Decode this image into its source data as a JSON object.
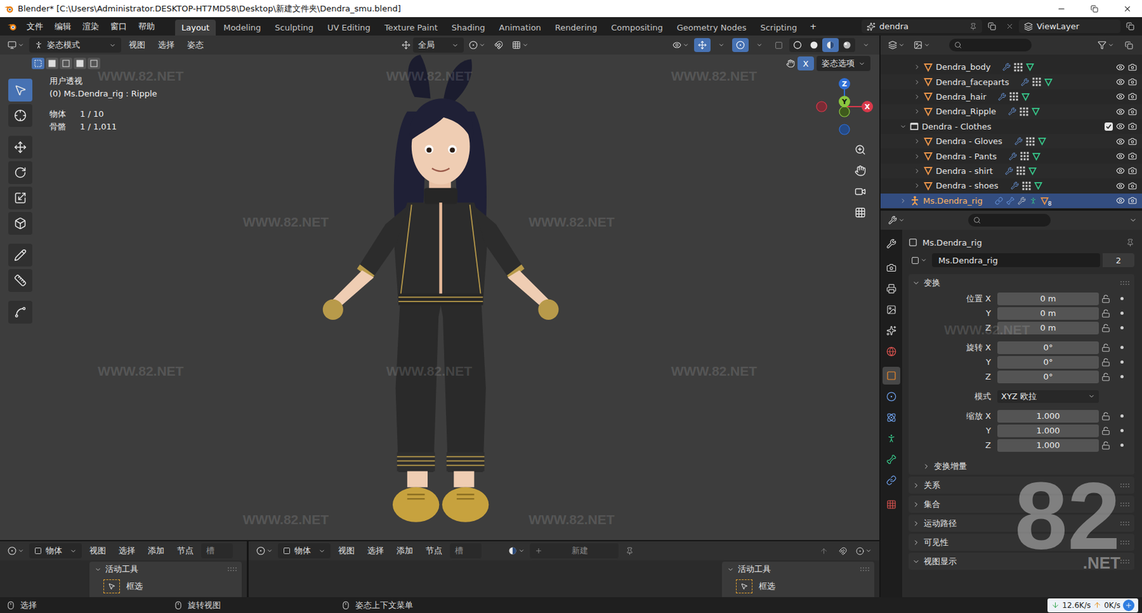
{
  "window": {
    "title": "Blender* [C:\\Users\\Administrator.DESKTOP-HT7MD58\\Desktop\\新建文件夹\\Dendra_smu.blend]"
  },
  "menu": [
    "文件",
    "编辑",
    "渲染",
    "窗口",
    "帮助"
  ],
  "workspaces": [
    {
      "label": "Layout",
      "selected": true
    },
    {
      "label": "Modeling",
      "selected": false
    },
    {
      "label": "Sculpting",
      "selected": false
    },
    {
      "label": "UV Editing",
      "selected": false
    },
    {
      "label": "Texture Paint",
      "selected": false
    },
    {
      "label": "Shading",
      "selected": false
    },
    {
      "label": "Animation",
      "selected": false
    },
    {
      "label": "Rendering",
      "selected": false
    },
    {
      "label": "Compositing",
      "selected": false
    },
    {
      "label": "Geometry Nodes",
      "selected": false
    },
    {
      "label": "Scripting",
      "selected": false
    }
  ],
  "add_workspace": "+",
  "scene": "dendra",
  "view_layer": "ViewLayer",
  "viewport": {
    "mode": "姿态模式",
    "menus": [
      "视图",
      "选择",
      "姿态"
    ],
    "orientation": "全局",
    "x_mirror": {
      "label": "X",
      "on": true
    },
    "pose_options": "姿态选项",
    "shading": [
      {
        "kind": "wireframe",
        "selected": false
      },
      {
        "kind": "solid",
        "selected": false
      },
      {
        "kind": "material",
        "selected": true
      },
      {
        "kind": "rendered",
        "selected": false
      }
    ],
    "view_name": "用户透视",
    "context": "(0) Ms.Dendra_rig : Ripple",
    "stats": [
      {
        "label": "物体",
        "value": "1 / 10"
      },
      {
        "label": "骨骼",
        "value": "1 / 1,011"
      }
    ],
    "gizmo": {
      "x": "X",
      "y": "Y",
      "z": "Z"
    },
    "tools": [
      {
        "kind": "select",
        "selected": true
      },
      {
        "kind": "cursor",
        "selected": false
      },
      {
        "kind": "move",
        "selected": false
      },
      {
        "kind": "rotate",
        "selected": false
      },
      {
        "kind": "scale",
        "selected": false
      },
      {
        "kind": "transform",
        "selected": false
      },
      {
        "kind": "annotate",
        "selected": false
      },
      {
        "kind": "measure",
        "selected": false
      },
      {
        "kind": "pose",
        "selected": false
      }
    ]
  },
  "bottom_editors": [
    {
      "editor": "物体",
      "menus": [
        "视图",
        "选择",
        "添加",
        "节点"
      ],
      "slot": "槽",
      "panel_title": "活动工具",
      "tool": "框选"
    },
    {
      "editor": "物体",
      "menus": [
        "视图",
        "选择",
        "添加",
        "节点"
      ],
      "slot": "槽",
      "new": "新建",
      "panel_title": "活动工具",
      "tool": "框选"
    }
  ],
  "status_bar": {
    "items": [
      "选择",
      "旋转视图",
      "姿态上下文菜单"
    ],
    "download": "12.6K/s",
    "upload": "0K/s"
  },
  "outliner": {
    "rows": [
      {
        "name": "Dendra_body",
        "kind": "mesh",
        "depth": 1,
        "expanded": false,
        "selected": false
      },
      {
        "name": "Dendra_faceparts",
        "kind": "mesh",
        "depth": 1,
        "expanded": false,
        "selected": false
      },
      {
        "name": "Dendra_hair",
        "kind": "mesh",
        "depth": 1,
        "expanded": false,
        "selected": false
      },
      {
        "name": "Dendra_Ripple",
        "kind": "mesh",
        "depth": 1,
        "expanded": false,
        "selected": false
      },
      {
        "name": "Dendra - Clothes",
        "kind": "collection",
        "depth": 0,
        "expanded": true,
        "selected": false,
        "checked": true
      },
      {
        "name": "Dendra - Gloves",
        "kind": "mesh",
        "depth": 1,
        "expanded": false,
        "selected": false
      },
      {
        "name": "Dendra - Pants",
        "kind": "mesh",
        "depth": 1,
        "expanded": false,
        "selected": false
      },
      {
        "name": "Dendra - shirt",
        "kind": "mesh",
        "depth": 1,
        "expanded": false,
        "selected": false
      },
      {
        "name": "Dendra - shoes",
        "kind": "mesh",
        "depth": 1,
        "expanded": false,
        "selected": false
      },
      {
        "name": "Ms.Dendra_rig",
        "kind": "armature",
        "depth": 0,
        "expanded": false,
        "selected": true,
        "badge": "8"
      }
    ]
  },
  "properties": {
    "object": "Ms.Dendra_rig",
    "datablock": "Ms.Dendra_rig",
    "users": "2",
    "tabs": [
      {
        "kind": "tool",
        "selected": false
      },
      {
        "kind": "render",
        "selected": false
      },
      {
        "kind": "output",
        "selected": false
      },
      {
        "kind": "view_layer",
        "selected": false
      },
      {
        "kind": "scene",
        "selected": false
      },
      {
        "kind": "world",
        "selected": false
      },
      {
        "kind": "object",
        "selected": true
      },
      {
        "kind": "constraint",
        "selected": false
      },
      {
        "kind": "physics",
        "selected": false
      },
      {
        "kind": "data",
        "selected": false
      },
      {
        "kind": "bone",
        "selected": false
      },
      {
        "kind": "bone_constraint",
        "selected": false
      },
      {
        "kind": "texture",
        "selected": false
      }
    ],
    "transform": {
      "title": "变换",
      "expanded": true,
      "groups": [
        {
          "kind": "fields",
          "rows": [
            {
              "label": "位置 X",
              "value": "0 m"
            },
            {
              "label": "Y",
              "value": "0 m"
            },
            {
              "label": "Z",
              "value": "0 m"
            }
          ]
        },
        {
          "kind": "fields",
          "rows": [
            {
              "label": "旋转 X",
              "value": "0°"
            },
            {
              "label": "Y",
              "value": "0°"
            },
            {
              "label": "Z",
              "value": "0°"
            }
          ]
        },
        {
          "kind": "select",
          "label": "模式",
          "value": "XYZ 欧拉"
        },
        {
          "kind": "fields",
          "rows": [
            {
              "label": "缩放 X",
              "value": "1.000"
            },
            {
              "label": "Y",
              "value": "1.000"
            },
            {
              "label": "Z",
              "value": "1.000"
            }
          ]
        }
      ],
      "delta": {
        "title": "变换增量",
        "expanded": false
      }
    },
    "sections": [
      {
        "title": "关系",
        "expanded": false
      },
      {
        "title": "集合",
        "expanded": false
      },
      {
        "title": "运动路径",
        "expanded": false
      },
      {
        "title": "可见性",
        "expanded": false
      },
      {
        "title": "视图显示",
        "expanded": true
      }
    ]
  },
  "watermark": {
    "text": "WWW.82.NET",
    "logo": "82",
    "logo_suffix": ".NET"
  }
}
